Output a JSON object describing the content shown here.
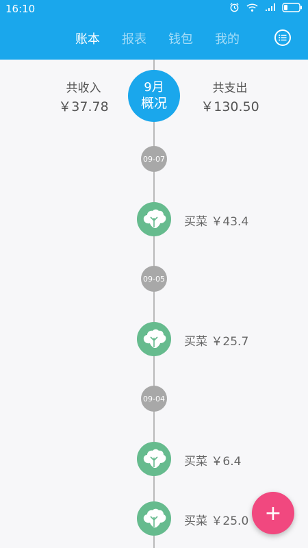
{
  "status_bar": {
    "time": "16:10",
    "icons": [
      "alarm-icon",
      "wifi-icon",
      "signal-icon",
      "battery-icon"
    ]
  },
  "tabs": [
    {
      "label": "账本",
      "active": true
    },
    {
      "label": "报表",
      "active": false
    },
    {
      "label": "钱包",
      "active": false
    },
    {
      "label": "我的",
      "active": false
    }
  ],
  "summary": {
    "income_label": "共收入",
    "income_amount": "￥37.78",
    "expense_label": "共支出",
    "expense_amount": "￥130.50",
    "month": "9月",
    "overview": "概况"
  },
  "timeline": {
    "dates": [
      "09-07",
      "09-05",
      "09-04"
    ],
    "entries": [
      {
        "category": "买菜",
        "amount": "￥43.4",
        "icon": "vegetable-icon"
      },
      {
        "category": "买菜",
        "amount": "￥25.7",
        "icon": "vegetable-icon"
      },
      {
        "category": "买菜",
        "amount": "￥6.4",
        "icon": "vegetable-icon"
      },
      {
        "category": "买菜",
        "amount": "￥25.0",
        "icon": "vegetable-icon"
      }
    ]
  },
  "fab": {
    "label": "+"
  },
  "colors": {
    "primary": "#1aa7ec",
    "date_dot": "#a8a8a8",
    "category": "#66bb8e",
    "fab": "#f1487f"
  }
}
